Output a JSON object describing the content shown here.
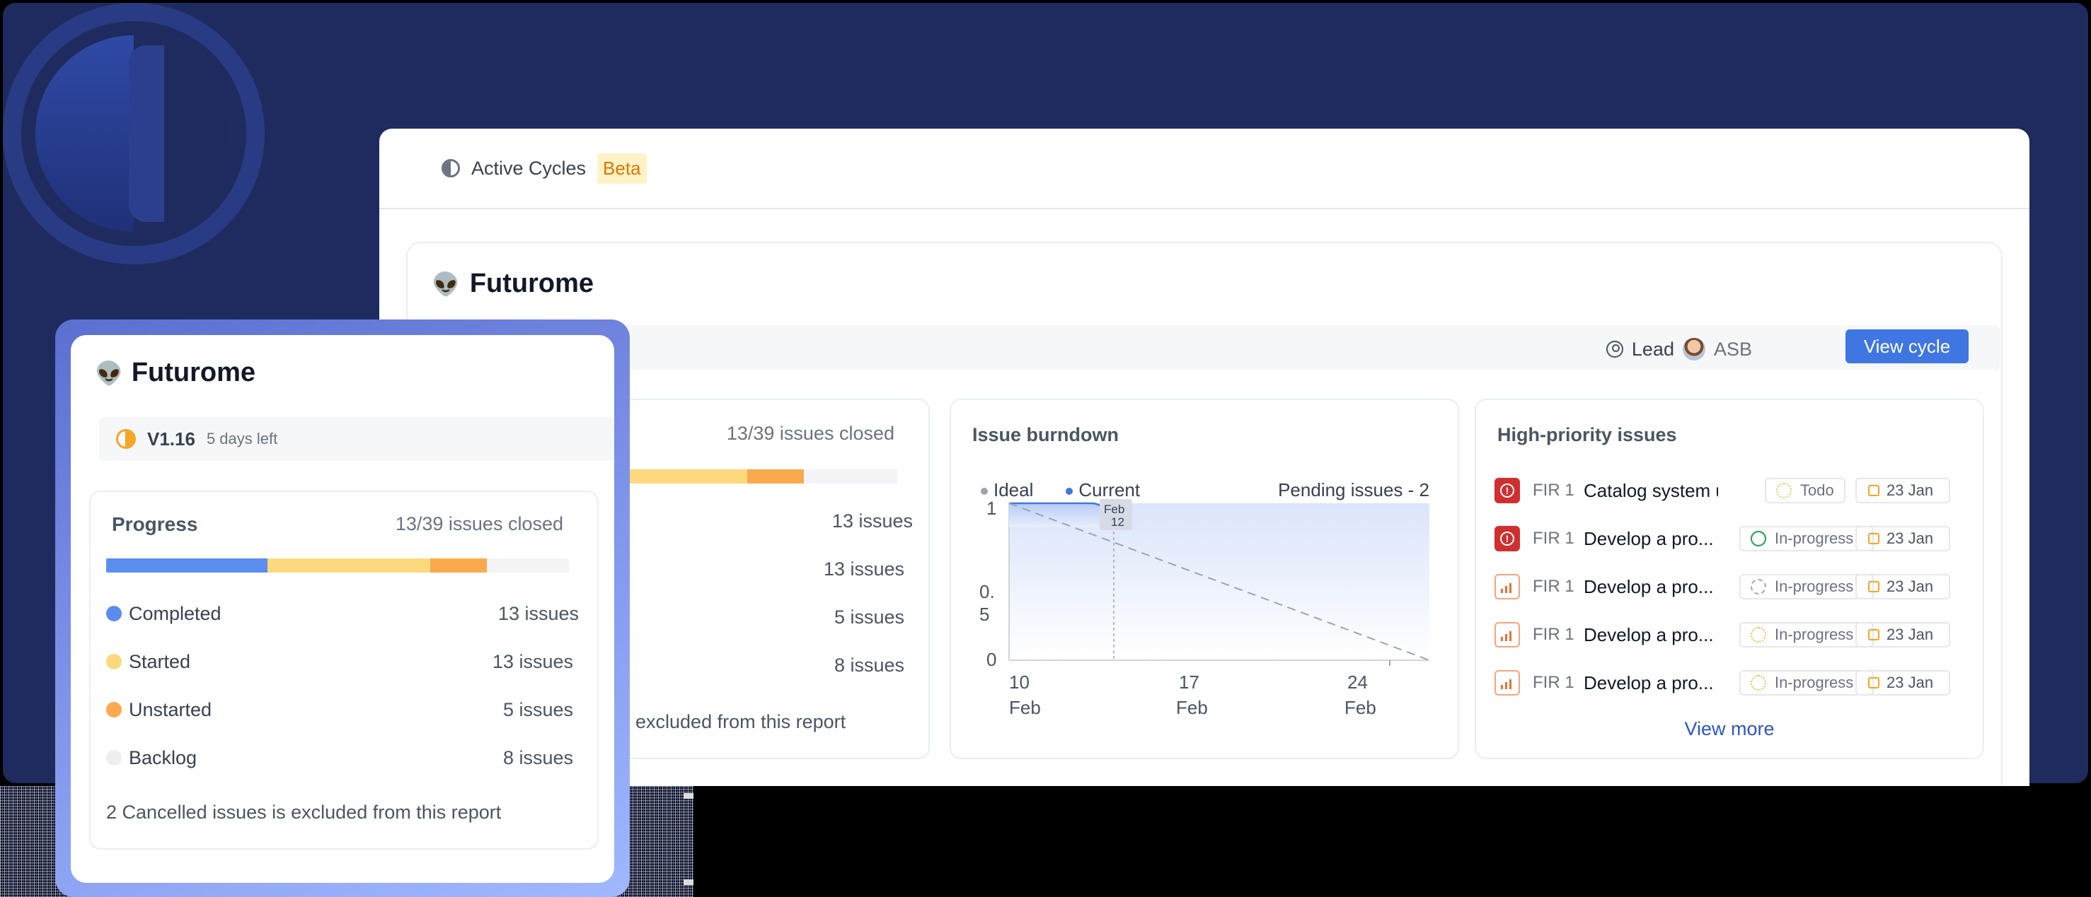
{
  "header": {
    "icon": "half-moon-icon",
    "title": "Active Cycles",
    "badge": "Beta"
  },
  "cycle": {
    "name": "Futurome",
    "lead_label": "Lead",
    "lead_user": "ASB",
    "view_cycle_label": "View cycle"
  },
  "progress": {
    "title": "Progress",
    "closed_text": "13/39 issues closed",
    "segments": [
      {
        "name": "Completed",
        "count": "13 issues",
        "value": 13,
        "color": "#5b8def"
      },
      {
        "name": "Started",
        "count": "13 issues",
        "value": 13,
        "color": "#fcd97d"
      },
      {
        "name": "Unstarted",
        "count": "5 issues",
        "value": 5,
        "color": "#fba94d"
      },
      {
        "name": "Backlog",
        "count": "8 issues",
        "value": 8,
        "color": "#eeeeee"
      }
    ],
    "note": "2 Cancelled issues is excluded from this report",
    "note_partial": "excluded from this report"
  },
  "burndown": {
    "title": "Issue burndown",
    "legend_ideal": "Ideal",
    "legend_current": "Current",
    "pending": "Pending issues - 2",
    "y_ticks": [
      "1",
      "0.",
      "5",
      "0"
    ],
    "x_ticks": [
      {
        "day": "10",
        "month": "Feb"
      },
      {
        "day": "17",
        "month": "Feb"
      },
      {
        "day": "24",
        "month": "Feb"
      }
    ],
    "marker_month": "Feb",
    "marker_day": "12",
    "colors": {
      "ideal": "#9ca3af",
      "current": "#3f76e2"
    }
  },
  "chart_data": {
    "type": "line",
    "title": "Issue burndown",
    "x_ticks": [
      "10 Feb",
      "17 Feb",
      "24 Feb"
    ],
    "ylim": [
      0,
      1
    ],
    "series": [
      {
        "name": "Ideal",
        "points": [
          [
            "10 Feb",
            1
          ],
          [
            "28 Feb",
            0
          ]
        ]
      },
      {
        "name": "Current",
        "points": [
          [
            "10 Feb",
            1
          ],
          [
            "11 Feb",
            1
          ],
          [
            "12 Feb",
            0.85
          ]
        ]
      }
    ]
  },
  "high_priority": {
    "title": "High-priority issues",
    "view_more": "View more",
    "issues": [
      {
        "priority": "urgent",
        "id": "FIR 1",
        "name": "Catalog system up...",
        "status": "Todo",
        "date": "23 Jan"
      },
      {
        "priority": "urgent",
        "id": "FIR 1",
        "name": "Develop a pro...",
        "status": "In-progress",
        "date": "23 Jan"
      },
      {
        "priority": "high",
        "id": "FIR 1",
        "name": "Develop a pro...",
        "status": "In-progress",
        "date": "23 Jan"
      },
      {
        "priority": "high",
        "id": "FIR 1",
        "name": "Develop a pro...",
        "status": "In-progress",
        "date": "23 Jan"
      },
      {
        "priority": "high",
        "id": "FIR 1",
        "name": "Develop a pro...",
        "status": "In-progress",
        "date": "23 Jan"
      }
    ]
  },
  "floating_card": {
    "name": "Futurome",
    "version": "V1.16",
    "days_left": "5 days left"
  }
}
